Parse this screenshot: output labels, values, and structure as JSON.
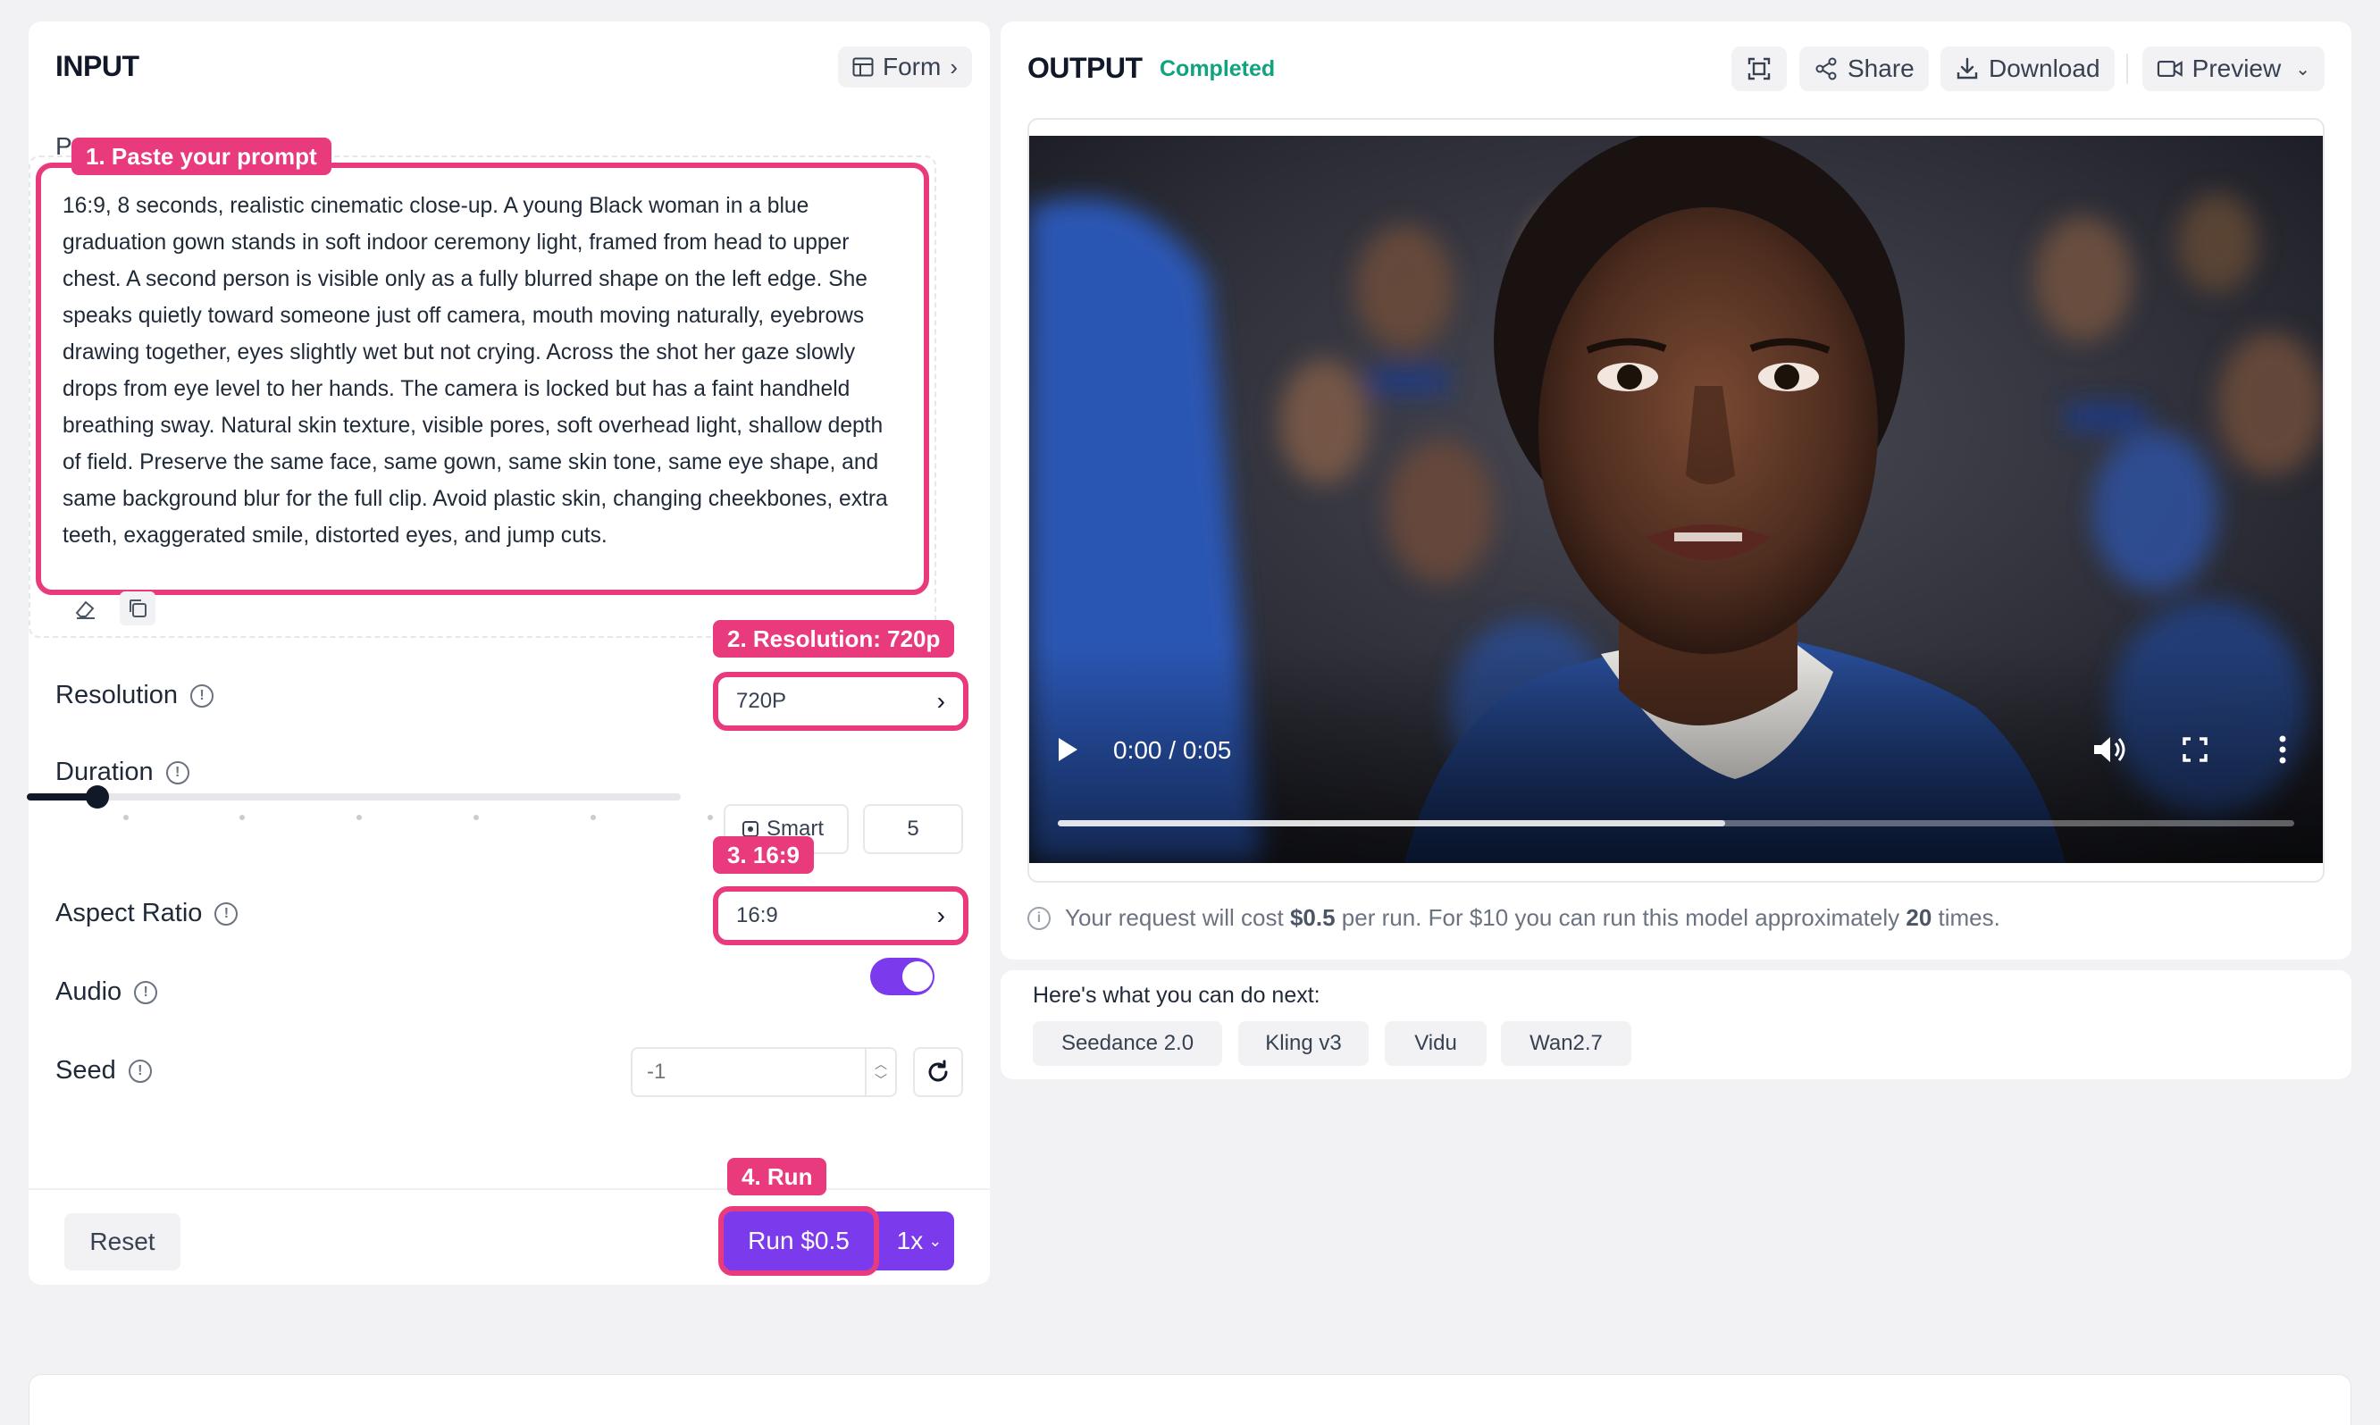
{
  "input": {
    "title": "INPUT",
    "form_label": "Form",
    "prompt_label": "Prompt",
    "prompt_text": "16:9, 8 seconds, realistic cinematic close-up. A young Black woman in a blue graduation gown stands in soft indoor ceremony light, framed from head to upper chest. A second person is visible only as a fully blurred shape on the left edge. She speaks quietly toward someone just off camera, mouth moving naturally, eyebrows drawing together, eyes slightly wet but not crying. Across the shot her gaze slowly drops from eye level to her hands. The camera is locked but has a faint handheld breathing sway. Natural skin texture, visible pores, soft overhead light, shallow depth of field. Preserve the same face, same gown, same skin tone, same eye shape, and same background blur for the full clip. Avoid plastic skin, changing cheekbones, extra teeth, exaggerated smile, distorted eyes, and jump cuts.",
    "resolution": {
      "label": "Resolution",
      "value": "720P"
    },
    "duration": {
      "label": "Duration",
      "smart_label": "Smart",
      "value": "5",
      "level": 0.08
    },
    "aspect_ratio": {
      "label": "Aspect Ratio",
      "value": "16:9"
    },
    "audio": {
      "label": "Audio",
      "enabled": true
    },
    "seed": {
      "label": "Seed",
      "placeholder": "-1"
    },
    "reset_label": "Reset",
    "run_label": "Run $0.5",
    "multiplier": "1x"
  },
  "annotations": {
    "step1": "1. Paste your prompt",
    "step2": "2. Resolution: 720p",
    "step3": "3. 16:9",
    "step4": "4. Run"
  },
  "output": {
    "title": "OUTPUT",
    "status": "Completed",
    "share_label": "Share",
    "download_label": "Download",
    "preview_label": "Preview",
    "video_time": "0:00 / 0:05",
    "video_progress": 0.54,
    "cost_prefix": "Your request will cost",
    "cost_value": "$0.5",
    "cost_mid": "per run. For $10 you can run this model approximately",
    "cost_runs": "20",
    "cost_suffix": "times."
  },
  "next": {
    "heading": "Here's what you can do next:",
    "chips": [
      "Seedance 2.0",
      "Kling v3",
      "Vidu",
      "Wan2.7"
    ]
  },
  "colors": {
    "accent_pink": "#e83a7d",
    "run_purple": "#7c3aed",
    "status_green": "#10a37f"
  }
}
